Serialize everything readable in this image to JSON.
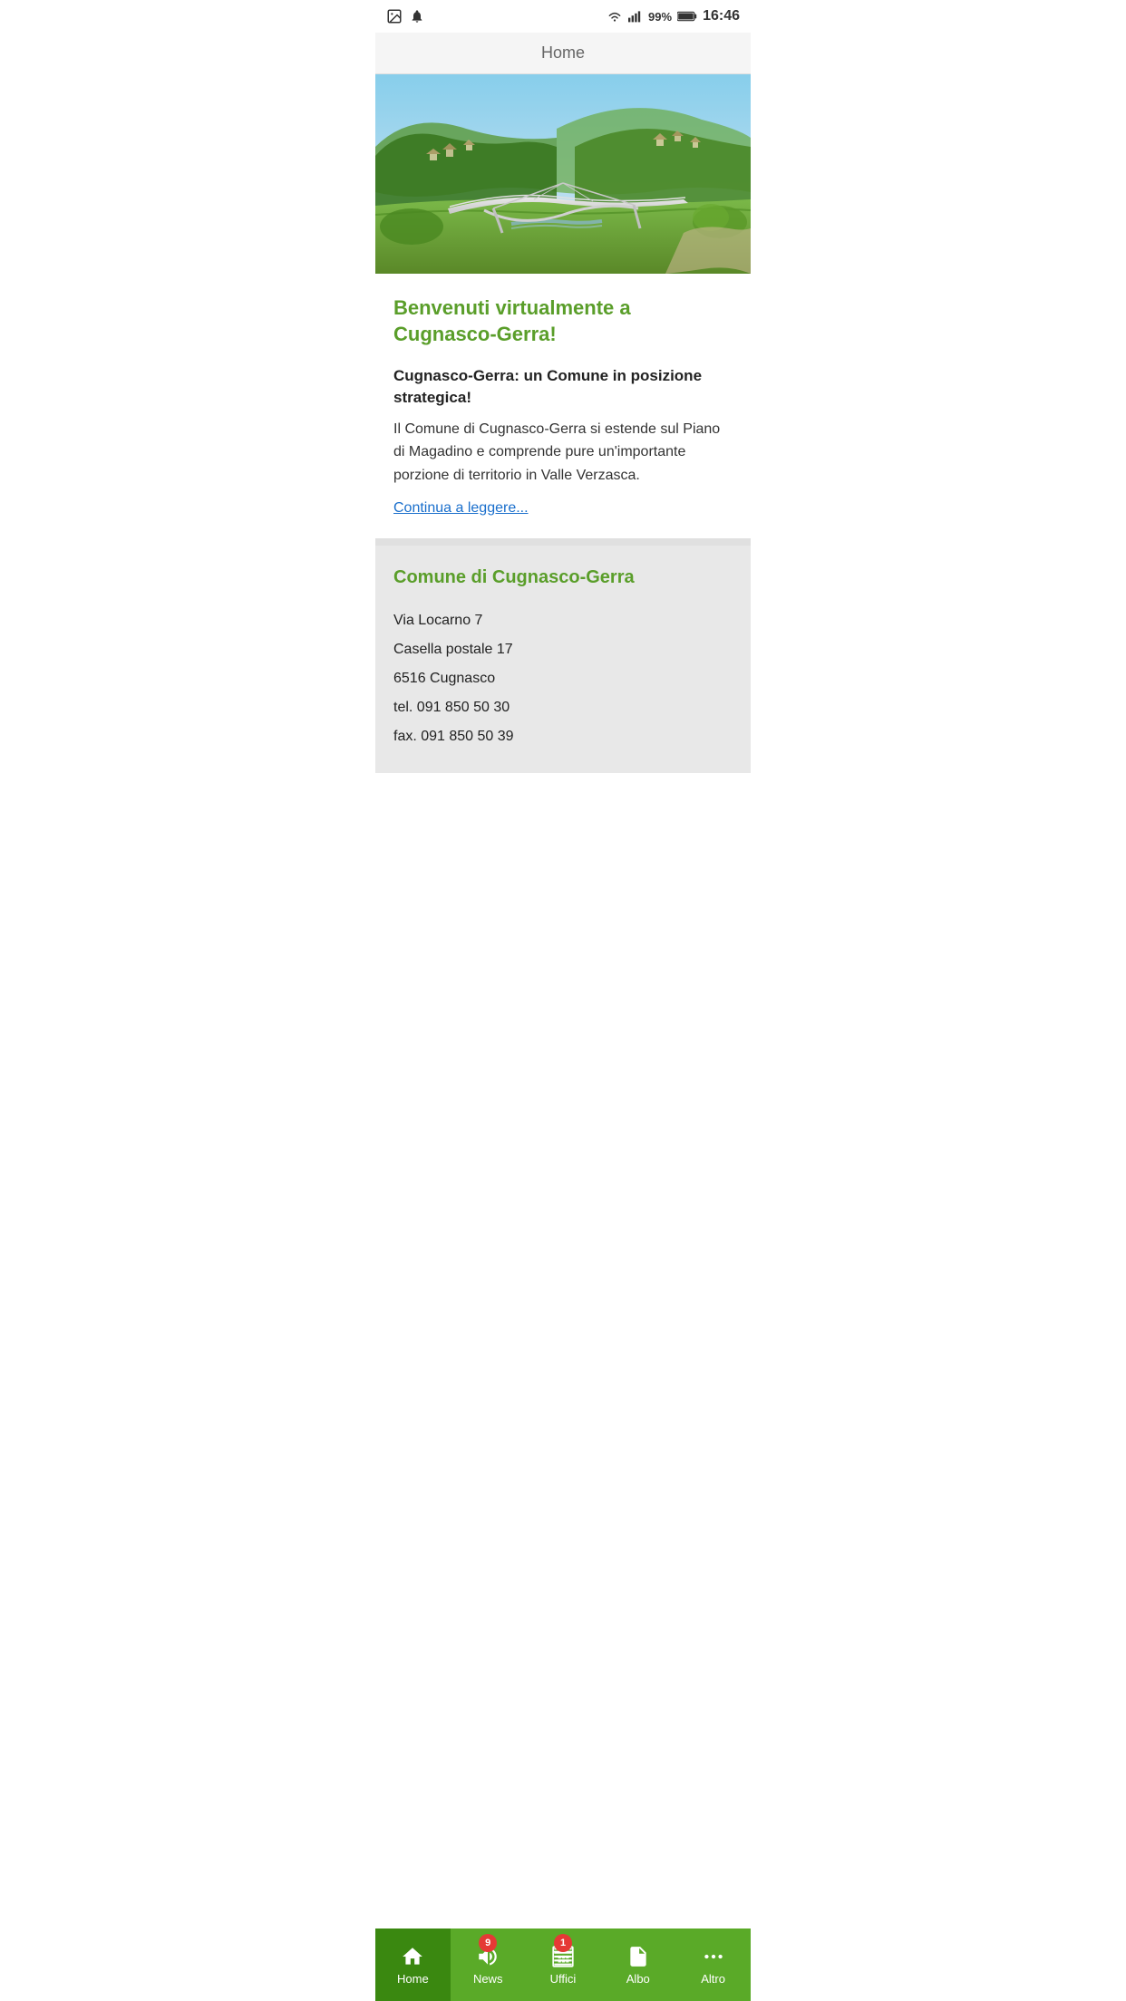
{
  "statusBar": {
    "time": "16:46",
    "battery": "99%",
    "signal": "●●●●",
    "wifi": "wifi"
  },
  "header": {
    "title": "Home"
  },
  "hero": {
    "altText": "Bridge in Cugnasco-Gerra landscape"
  },
  "content": {
    "welcomeTitle": "Benvenuti virtualmente a Cugnasco-Gerra!",
    "subtitle": "Cugnasco-Gerra: un Comune in posizione strategica!",
    "body": "Il Comune di Cugnasco-Gerra si estende sul Piano di Magadino e comprende pure un'importante porzione di territorio in Valle Verzasca.",
    "readMoreLink": "Continua a leggere..."
  },
  "infoSection": {
    "title": "Comune di Cugnasco-Gerra",
    "address1": "Via Locarno 7",
    "address2": "Casella postale 17",
    "address3": "6516 Cugnasco",
    "phone": "tel. 091 850 50 30",
    "fax": "fax. 091 850 50 39"
  },
  "bottomNav": {
    "items": [
      {
        "id": "home",
        "label": "Home",
        "icon": "home",
        "active": true,
        "badge": null
      },
      {
        "id": "news",
        "label": "News",
        "icon": "megaphone",
        "active": false,
        "badge": "9"
      },
      {
        "id": "uffici",
        "label": "Uffici",
        "icon": "office",
        "active": false,
        "badge": "1"
      },
      {
        "id": "albo",
        "label": "Albo",
        "icon": "document",
        "active": false,
        "badge": null
      },
      {
        "id": "altro",
        "label": "Altro",
        "icon": "dots",
        "active": false,
        "badge": null
      }
    ]
  }
}
